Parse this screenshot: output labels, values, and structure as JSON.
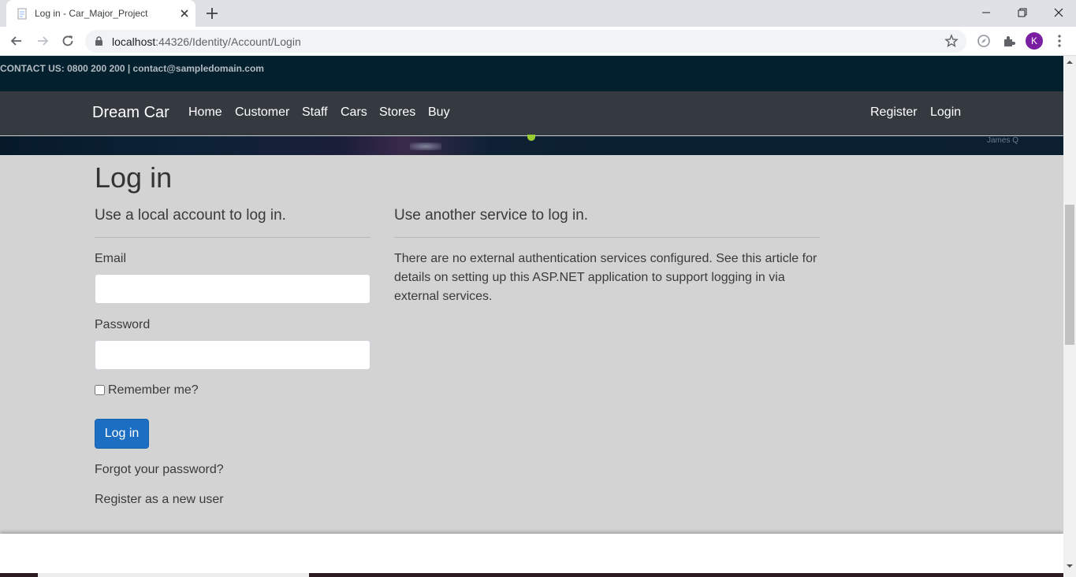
{
  "browser": {
    "tab_title": "Log in - Car_Major_Project",
    "url_host": "localhost",
    "url_rest": ":44326/Identity/Account/Login",
    "profile_initial": "K"
  },
  "site": {
    "contact": "CONTACT US: 0800 200 200 | contact@sampledomain.com",
    "brand": "Dream Car",
    "nav": {
      "home": "Home",
      "customer": "Customer",
      "staff": "Staff",
      "cars": "Cars",
      "stores": "Stores",
      "buy": "Buy",
      "register": "Register",
      "login": "Login"
    },
    "hero_signature": "James Q"
  },
  "page": {
    "title": "Log in",
    "local": {
      "heading": "Use a local account to log in.",
      "email_label": "Email",
      "email_value": "",
      "password_label": "Password",
      "password_value": "",
      "remember_label": "Remember me?",
      "remember_checked": false,
      "submit_label": "Log in",
      "forgot_link": "Forgot your password?",
      "register_link": "Register as a new user"
    },
    "external": {
      "heading": "Use another service to log in.",
      "message": "There are no external authentication services configured. See this article for details on setting up this ASP.NET application to support logging in via external services."
    }
  },
  "colors": {
    "contact_bar": "#03202f",
    "navbar": "#343a40",
    "page_bg": "#d3d3d3",
    "primary_button": "#1b6ec2",
    "avatar": "#7b1fa2"
  }
}
